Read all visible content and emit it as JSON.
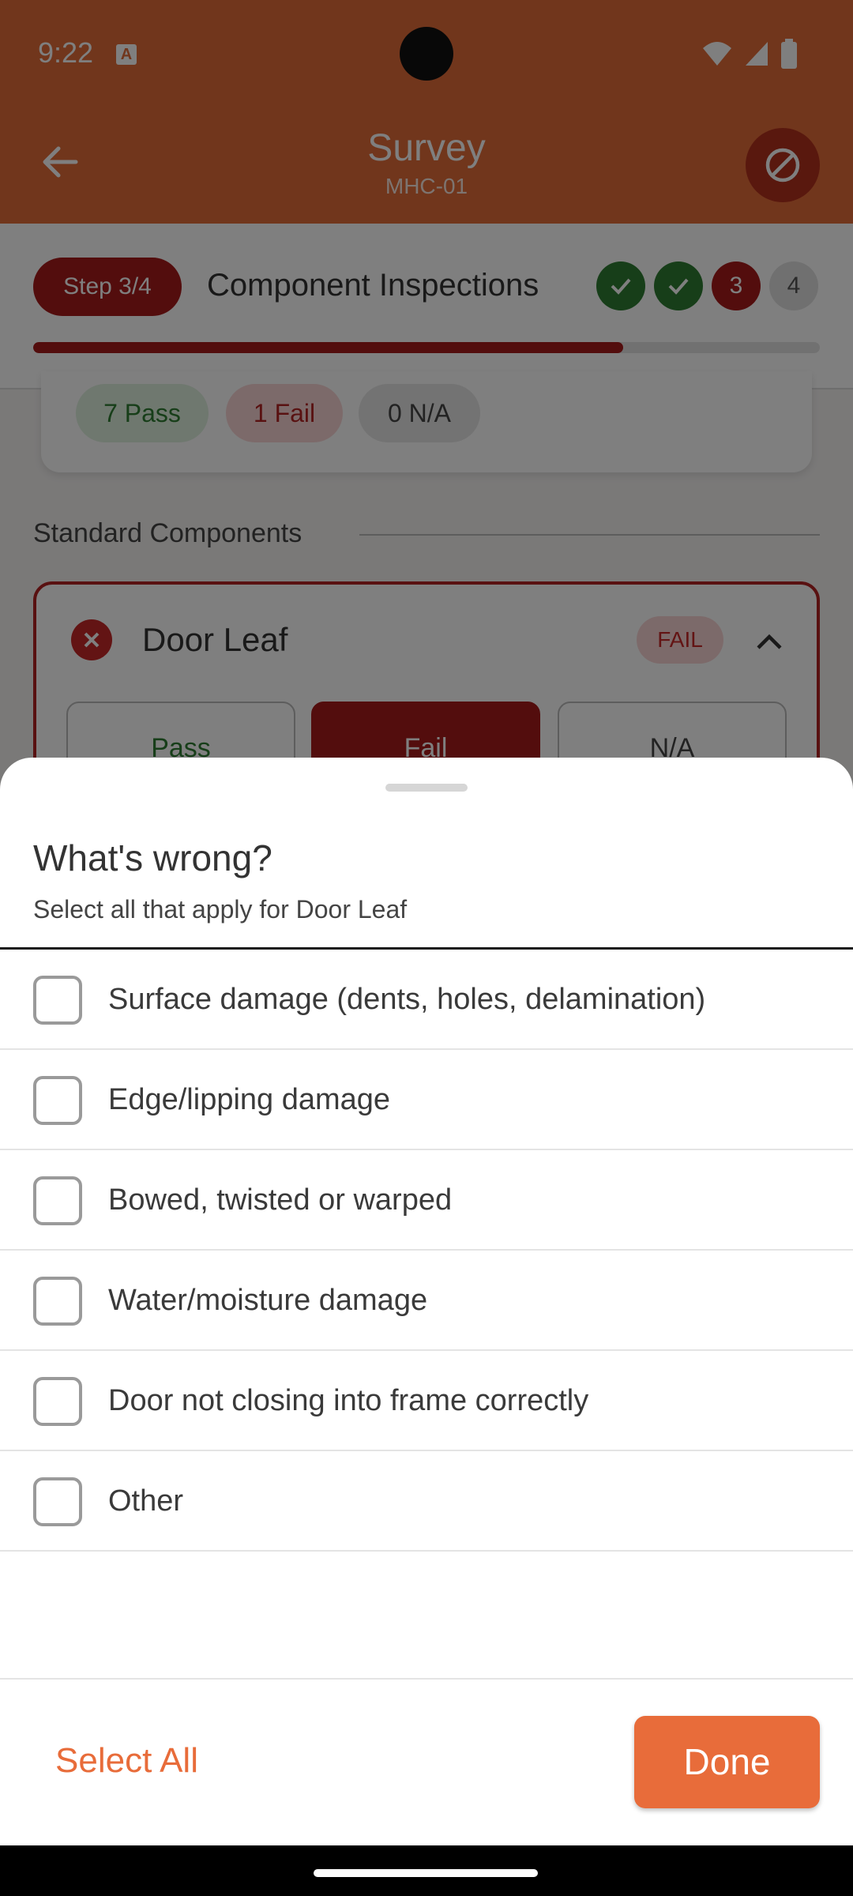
{
  "status_bar": {
    "time": "9:22",
    "notification_icon": "a-icon"
  },
  "app_bar": {
    "title": "Survey",
    "subtitle": "MHC-01",
    "back_icon": "arrow-left-icon",
    "action_icon": "block-icon"
  },
  "stepper": {
    "step_label": "Step 3/4",
    "title": "Component Inspections",
    "steps": [
      {
        "state": "done",
        "label": ""
      },
      {
        "state": "done",
        "label": ""
      },
      {
        "state": "current",
        "label": "3"
      },
      {
        "state": "pending",
        "label": "4"
      }
    ],
    "progress": 0.75
  },
  "summary": {
    "pass": "7 Pass",
    "fail": "1 Fail",
    "na": "0 N/A"
  },
  "section": {
    "title": "Standard Components"
  },
  "door_card": {
    "title": "Door Leaf",
    "badge": "FAIL",
    "options": [
      "Pass",
      "Fail",
      "N/A"
    ],
    "selected": "Fail"
  },
  "sheet": {
    "title": "What's wrong?",
    "subtitle": "Select all that apply for Door Leaf",
    "items": [
      {
        "label": "Surface damage (dents, holes, delamination)",
        "checked": false
      },
      {
        "label": "Edge/lipping damage",
        "checked": false
      },
      {
        "label": "Bowed, twisted or warped",
        "checked": false
      },
      {
        "label": "Water/moisture damage",
        "checked": false
      },
      {
        "label": "Door not closing into frame correctly",
        "checked": false
      },
      {
        "label": "Other",
        "checked": false
      }
    ],
    "select_all_label": "Select All",
    "done_label": "Done"
  },
  "colors": {
    "accent": "#e86c3a",
    "fail": "#a61b1b",
    "pass": "#2e7d32"
  }
}
